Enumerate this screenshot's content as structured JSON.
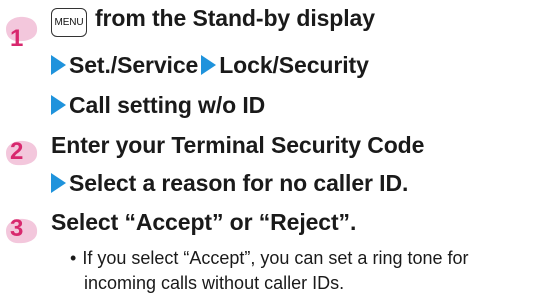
{
  "steps": [
    {
      "number": "1",
      "menu_key": "MENU",
      "line1": "from the Stand-by display",
      "path": [
        "Set./Service",
        "Lock/Security",
        "Call setting w/o ID"
      ]
    },
    {
      "number": "2",
      "line1": "Enter your Terminal Security Code",
      "line2": "Select a reason for no caller ID."
    },
    {
      "number": "3",
      "line1": "Select “Accept” or “Reject”.",
      "note_bullet": "•",
      "note_line1": "If you select “Accept”, you can set a ring tone for",
      "note_line2": "incoming calls without caller IDs."
    }
  ],
  "colors": {
    "badge_fill": "#f3c7dc",
    "number": "#d8286e",
    "arrow": "#1f93dc",
    "text": "#1a1a1a"
  }
}
